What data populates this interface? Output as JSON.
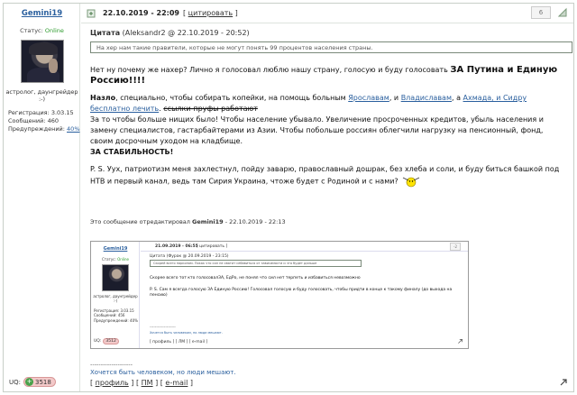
{
  "user": {
    "name": "Gemini19",
    "status_label": "Статус:",
    "status_value": "Online",
    "signature_lines": [
      "астролог, даунгрейдер",
      ":-)"
    ],
    "registration": "Регистрация: 3.03.15",
    "messages": "Сообщений: 460",
    "warnings_label": "Предупреждений:",
    "warnings_value": "40%",
    "uq_label": "UQ:",
    "uq_value": "3518"
  },
  "post": {
    "date": "22.10.2019 - 22:09",
    "quote_link": "цитировать",
    "number": "6",
    "quote_title_label": "Цитата",
    "quote_title_meta": "(Aleksandr2 @ 22.10.2019 - 20:52)",
    "quote_body": "На хер нам такие правители, которые не могут понять 99 процентов населения страны.",
    "p1_text": "Нет ну почему же нахер? Лично я голосовал люблю нашу страну, голосую и буду голосовать",
    "p1_bold": "ЗА Путина и Единую Россию!!!!",
    "p2_bold": "Назло",
    "p2_text1": ", специально, чтобы собирать копейки, на помощь больным",
    "p2_link1": "Ярославам",
    "p2_text2": ", и",
    "p2_link2": "Владиславам",
    "p2_text3": ", а",
    "p2_link3": "Ахмада, и Сидру бесплатно лечить",
    "p2_text4": ".",
    "p2_strike": "ссылки-пруфы работают",
    "p3": "За то чтобы больше нищих было! Чтобы население убывало. Увеличение просроченных кредитов, убыль населения и замену специалистов, гастарбайтерами из Азии. Чтобы побольше россиян облегчили нагрузку на пенсионный, фонд, своим досрочным уходом на кладбище.",
    "p3_bold": "ЗА СТАБИЛЬНОСТЬ!",
    "p4": "P. S. Уух, патриотизм меня захлестнул, пойду заварю, православный дошрак, без хлеба и соли, и буду биться башкой под НТВ и первый канал, ведь там Сирия Украина, чтоже будет с Родиной и с нами?",
    "edited_text": "Это сообщение отредактировал",
    "edited_user": "Gemini19",
    "edited_date": "- 22.10.2019 - 22:13",
    "separator": "--------------------",
    "signature": "Хочется быть человеком, но люди мешают."
  },
  "embedded": {
    "user": "Gemini19",
    "status_label": "Статус:",
    "status_value": "Online",
    "sig_lines": [
      "астролог, даунгрейдер",
      ":-)"
    ],
    "registration": "Регистрация: 3.03.15",
    "messages": "Сообщений: 456",
    "warnings": "Предупреждений: 40%",
    "uq_label": "UQ:",
    "uq_value": "3512",
    "date": "21.09.2019 - 06:55",
    "quote_link": "[ цитировать ]",
    "number": "-2",
    "quote_title": "Цитата (Фурак @ 20.09.2019 - 23:15)",
    "quote_body": "Скорей всего нарконом. Покак что сил не хватит избавиться от зависимости и что будет дальше",
    "t1": "Скорее всего тот кто голосовалЗА, ЕдРо, не понял что сил нет терпеть и избавиться невозможно",
    "t2": "P. S. Сам я всегда голосую ЗА Единую Россию! Голосовал голосую и буду голосовать, чтобы придти в конце к такому финалу (до выхода на пенсию)",
    "sep": "--------------------",
    "sig": "Хочется быть человеком, но люди мешают.",
    "footer": "[ профиль ] [ ЛМ ] [ e-mail ]"
  },
  "footer": {
    "profile": "профиль",
    "pm": "ПМ",
    "email": "e-mail"
  }
}
